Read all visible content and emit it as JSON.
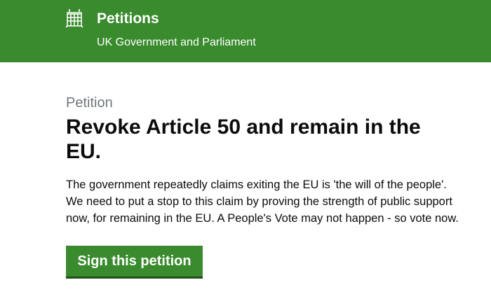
{
  "header": {
    "logo_icon": "portcullis-icon",
    "title": "Petitions",
    "subtitle": "UK Government and Parliament",
    "background_color": "#3a8b2e"
  },
  "petition": {
    "caption": "Petition",
    "title": "Revoke Article 50 and remain in the EU.",
    "description": "The government repeatedly claims exiting the EU is 'the will of the people'. We need to put a stop to this claim by proving the strength of public support now, for remaining in the EU. A People's Vote may not happen - so vote now.",
    "sign_button_label": "Sign this petition",
    "button_color": "#3a8b2e"
  }
}
